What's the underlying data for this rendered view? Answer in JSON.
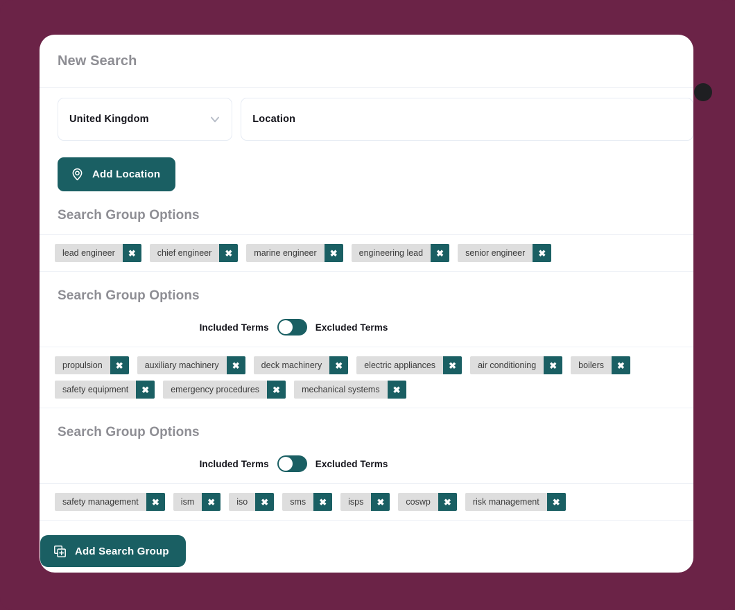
{
  "card": {
    "title": "New Search",
    "close_icon": "close-circle-icon"
  },
  "location": {
    "country_select": {
      "value": "United  Kingdom",
      "chevron_icon": "chevron-down-icon"
    },
    "location_input": {
      "placeholder": "Location",
      "value": ""
    },
    "add_location_button": {
      "label": "Add Location",
      "icon": "map-pin-icon"
    }
  },
  "toggle": {
    "included_label": "Included Terms",
    "excluded_label": "Excluded Terms",
    "state": "included"
  },
  "groups": [
    {
      "title": "Search Group Options",
      "has_toggle": false,
      "tags": [
        "lead engineer",
        "chief engineer",
        "marine engineer",
        "engineering lead",
        "senior engineer"
      ]
    },
    {
      "title": "Search Group Options",
      "has_toggle": true,
      "tags": [
        "propulsion",
        "auxiliary machinery",
        "deck machinery",
        "electric appliances",
        "air conditioning",
        "boilers",
        "safety equipment",
        "emergency procedures",
        "mechanical systems"
      ]
    },
    {
      "title": "Search Group Options",
      "has_toggle": true,
      "tags": [
        "safety management",
        "ism",
        "iso",
        "sms",
        "isps",
        "coswp",
        "risk management"
      ]
    }
  ],
  "footer": {
    "add_search_group_button": {
      "label": "Add Search Group",
      "icon": "add-copy-icon"
    }
  },
  "colors": {
    "page_background": "#6b2347",
    "accent_teal": "#1a5f63",
    "card_background": "#ffffff",
    "tag_background": "#dedede",
    "muted_text": "#8e8e94"
  },
  "tag_remove_icon": "close-x-icon"
}
